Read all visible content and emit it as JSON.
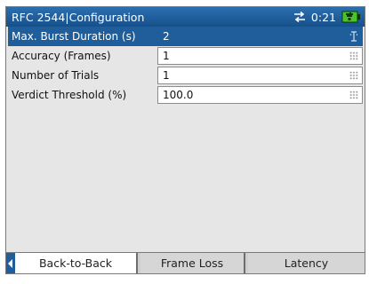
{
  "titlebar": {
    "title": "RFC 2544|Configuration",
    "time": "0:21"
  },
  "rows": [
    {
      "label": "Max. Burst Duration (s)",
      "value": "2",
      "selected": true
    },
    {
      "label": "Accuracy (Frames)",
      "value": "1",
      "selected": false
    },
    {
      "label": "Number of Trials",
      "value": "1",
      "selected": false
    },
    {
      "label": "Verdict Threshold (%)",
      "value": "100.0",
      "selected": false
    }
  ],
  "tabs": [
    {
      "label": "Back-to-Back",
      "active": true
    },
    {
      "label": "Frame Loss",
      "active": false
    },
    {
      "label": "Latency",
      "active": false
    }
  ],
  "colors": {
    "titlebar": "#1f5e9a",
    "selection": "#1f5e9a",
    "battery": "#4cc428"
  }
}
